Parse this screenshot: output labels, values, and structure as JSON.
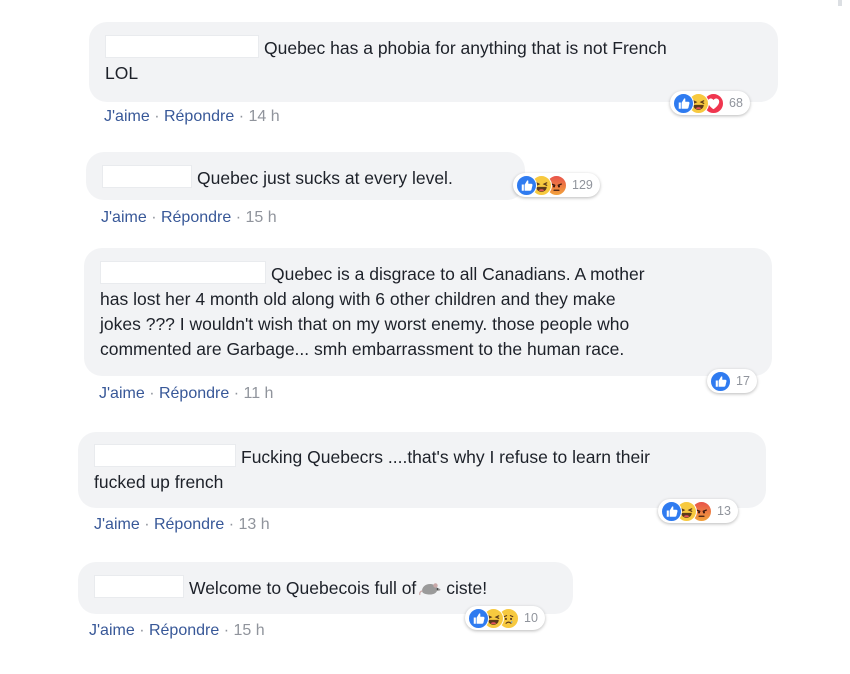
{
  "comments": [
    {
      "text_line1": "Quebec has a phobia for anything that is not French",
      "text_line2": "LOL",
      "actions": {
        "like": "J'aime",
        "reply": "Répondre",
        "time": "14 h"
      },
      "reactions": {
        "icons": [
          "like-icon",
          "haha-icon",
          "love-icon"
        ],
        "count": "68"
      }
    },
    {
      "text_line1": "Quebec just sucks at every level.",
      "actions": {
        "like": "J'aime",
        "reply": "Répondre",
        "time": "15 h"
      },
      "reactions": {
        "icons": [
          "like-icon",
          "haha-icon",
          "angry-icon"
        ],
        "count": "129"
      }
    },
    {
      "text_line1": "Quebec is a disgrace to all Canadians. A mother",
      "text_line2": "has lost her 4 month old along with 6 other children and they make",
      "text_line3": "jokes ??? I wouldn't wish that on my worst enemy. those people who",
      "text_line4": "commented are Garbage... smh embarrassment to the human race.",
      "actions": {
        "like": "J'aime",
        "reply": "Répondre",
        "time": "11 h"
      },
      "reactions": {
        "icons": [
          "like-icon"
        ],
        "count": "17"
      }
    },
    {
      "text_line1": "Fucking Quebecrs ....that's why I refuse to learn their",
      "text_line2": "fucked up french",
      "actions": {
        "like": "J'aime",
        "reply": "Répondre",
        "time": "13 h"
      },
      "reactions": {
        "icons": [
          "like-icon",
          "haha-icon",
          "angry-icon"
        ],
        "count": "13"
      }
    },
    {
      "text_before": "Welcome to Quebecois full of",
      "emoji": "rat-icon",
      "text_after": "ciste!",
      "actions": {
        "like": "J'aime",
        "reply": "Répondre",
        "time": "15 h"
      },
      "reactions": {
        "icons": [
          "like-icon",
          "haha-icon",
          "sad-icon"
        ],
        "count": "10"
      }
    }
  ],
  "colors": {
    "bubble": "#f2f3f5",
    "link": "#385898",
    "meta": "#90949c",
    "like": "#2f7bf0",
    "haha": "#f7c93f",
    "love": "#f0364f",
    "angry": "#e8534b"
  }
}
